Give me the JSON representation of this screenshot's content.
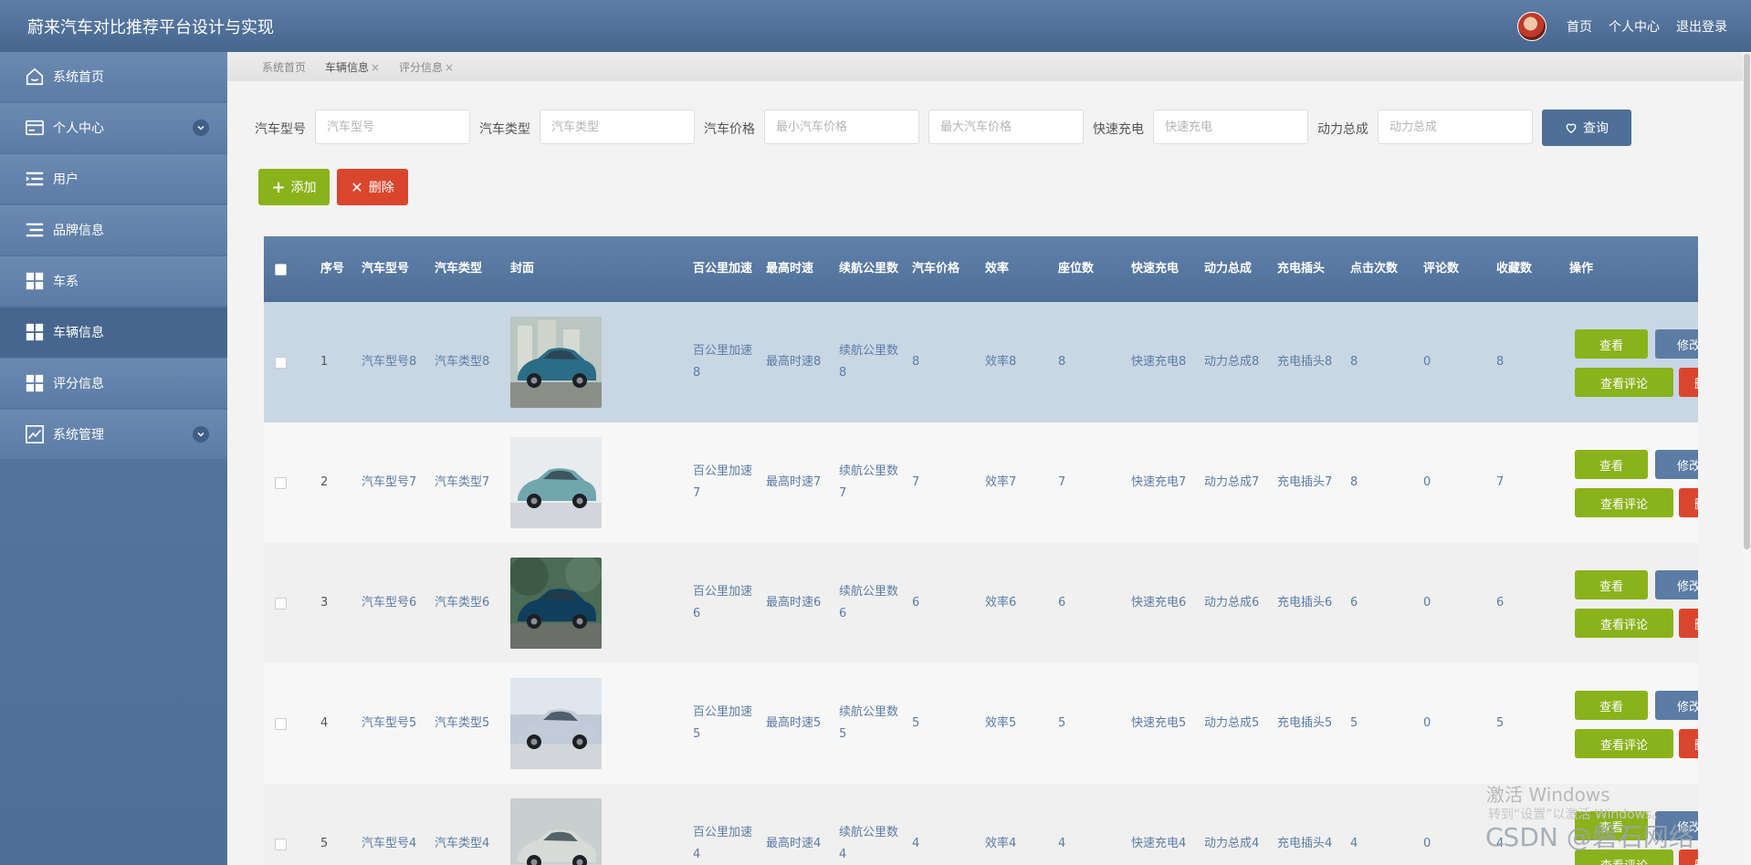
{
  "header": {
    "title": "蔚来汽车对比推荐平台设计与实现",
    "links": [
      "首页",
      "个人中心",
      "退出登录"
    ]
  },
  "sidebar": {
    "items": [
      {
        "label": "系统首页",
        "icon": "home-icon"
      },
      {
        "label": "个人中心",
        "icon": "card-icon",
        "expand": true
      },
      {
        "label": "用户",
        "icon": "list-indent-icon"
      },
      {
        "label": "品牌信息",
        "icon": "list-icon"
      },
      {
        "label": "车系",
        "icon": "grid-icon"
      },
      {
        "label": "车辆信息",
        "icon": "grid-icon",
        "active": true
      },
      {
        "label": "评分信息",
        "icon": "grid-icon"
      },
      {
        "label": "系统管理",
        "icon": "chart-icon",
        "expand": true
      }
    ]
  },
  "tabs": [
    {
      "label": "系统首页"
    },
    {
      "label": "车辆信息",
      "close": "×"
    },
    {
      "label": "评分信息",
      "close": "×"
    }
  ],
  "search": {
    "fields": [
      {
        "label": "汽车型号",
        "placeholder": "汽车型号"
      },
      {
        "label": "汽车类型",
        "placeholder": "汽车类型"
      },
      {
        "label": "汽车价格",
        "placeholder": "最小汽车价格"
      },
      {
        "label": "",
        "placeholder": "最大汽车价格"
      },
      {
        "label": "快速充电",
        "placeholder": "快速充电"
      },
      {
        "label": "动力总成",
        "placeholder": "动力总成"
      }
    ],
    "query_label": "查询"
  },
  "toolbar": {
    "add_label": "添加",
    "delete_label": "删除"
  },
  "table": {
    "headers": [
      "序号",
      "汽车型号",
      "汽车类型",
      "封面",
      "百公里加速",
      "最高时速",
      "续航公里数",
      "汽车价格",
      "效率",
      "座位数",
      "快速充电",
      "动力总成",
      "充电插头",
      "点击次数",
      "评论数",
      "收藏数",
      "操作"
    ],
    "rows": [
      {
        "index": "1",
        "model": "汽车型号8",
        "type": "汽车类型8",
        "accel": "百公里加速8",
        "speed": "最高时速8",
        "range": "续航公里数8",
        "price": "8",
        "efficiency": "效率8",
        "seats": "8",
        "fast_charge": "快速充电8",
        "powertrain": "动力总成8",
        "plug": "充电插头8",
        "clicks": "8",
        "comments": "0",
        "favorites": "8"
      },
      {
        "index": "2",
        "model": "汽车型号7",
        "type": "汽车类型7",
        "accel": "百公里加速7",
        "speed": "最高时速7",
        "range": "续航公里数7",
        "price": "7",
        "efficiency": "效率7",
        "seats": "7",
        "fast_charge": "快速充电7",
        "powertrain": "动力总成7",
        "plug": "充电插头7",
        "clicks": "8",
        "comments": "0",
        "favorites": "7"
      },
      {
        "index": "3",
        "model": "汽车型号6",
        "type": "汽车类型6",
        "accel": "百公里加速6",
        "speed": "最高时速6",
        "range": "续航公里数6",
        "price": "6",
        "efficiency": "效率6",
        "seats": "6",
        "fast_charge": "快速充电6",
        "powertrain": "动力总成6",
        "plug": "充电插头6",
        "clicks": "6",
        "comments": "0",
        "favorites": "6"
      },
      {
        "index": "4",
        "model": "汽车型号5",
        "type": "汽车类型5",
        "accel": "百公里加速5",
        "speed": "最高时速5",
        "range": "续航公里数5",
        "price": "5",
        "efficiency": "效率5",
        "seats": "5",
        "fast_charge": "快速充电5",
        "powertrain": "动力总成5",
        "plug": "充电插头5",
        "clicks": "5",
        "comments": "0",
        "favorites": "5"
      },
      {
        "index": "5",
        "model": "汽车型号4",
        "type": "汽车类型4",
        "accel": "百公里加速4",
        "speed": "最高时速4",
        "range": "续航公里数4",
        "price": "4",
        "efficiency": "效率4",
        "seats": "4",
        "fast_charge": "快速充电4",
        "powertrain": "动力总成4",
        "plug": "充电插头4",
        "clicks": "4",
        "comments": "0",
        "favorites": "4"
      }
    ],
    "actions": {
      "view": "查看",
      "edit": "修改",
      "comment": "查看评论",
      "delete": "删除"
    }
  },
  "watermark": {
    "line1": "激活 Windows",
    "line2": "转到“设置”以激活 Windows。",
    "csdn": "CSDN @磐石网络"
  },
  "colors": {
    "primary": "#4e6f97",
    "green": "#8ab21b",
    "red": "#d9462d",
    "highlight": "#c9d6e4"
  }
}
